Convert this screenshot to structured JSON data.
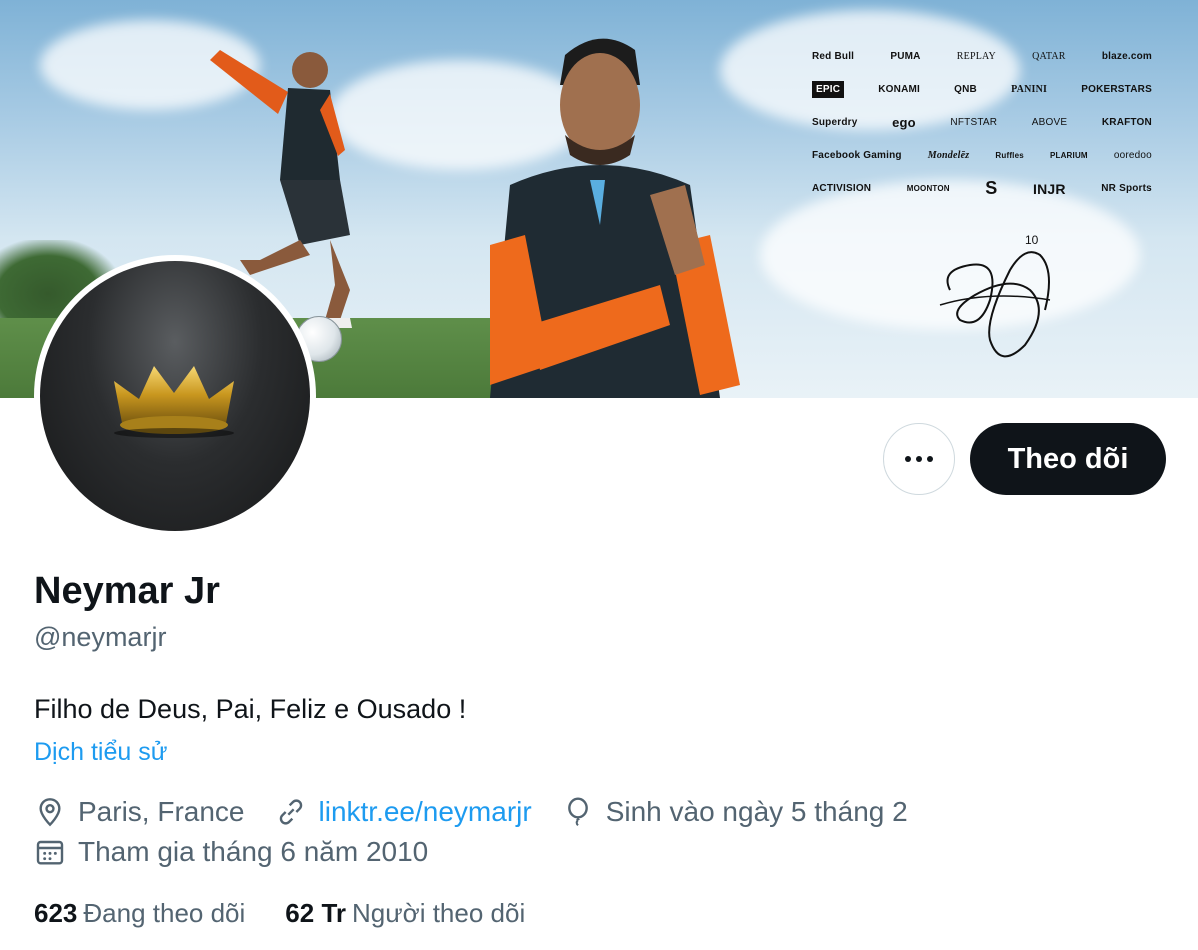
{
  "banner": {
    "sponsors": [
      [
        "Red Bull",
        "PUMA",
        "REPLAY",
        "QATAR",
        "blaze.com"
      ],
      [
        "EPIC",
        "KONAMI",
        "QNB",
        "PANINI",
        "POKERSTARS"
      ],
      [
        "Superdry",
        "ego",
        "NFTSTAR",
        "ABOVE",
        "KRAFTON"
      ],
      [
        "Facebook Gaming",
        "Mondelēz",
        "Ruffles",
        "PLARIUM",
        "ooredoo"
      ],
      [
        "ACTIVISION",
        "MOONTON",
        "S",
        "INJR",
        "NR Sports"
      ]
    ],
    "signature_number": "10"
  },
  "profile": {
    "name": "Neymar Jr",
    "handle": "@neymarjr",
    "bio": "Filho de Deus, Pai, Feliz e Ousado !",
    "translate_label": "Dịch tiểu sử",
    "location": "Paris, France",
    "website": "linktr.ee/neymarjr",
    "birthday": "Sinh vào ngày 5 tháng 2",
    "joined": "Tham gia tháng 6 năm 2010"
  },
  "actions": {
    "follow_label": "Theo dõi",
    "more_label": "•••"
  },
  "stats": {
    "following_count": "623",
    "following_label": "Đang theo dõi",
    "followers_count": "62 Tr",
    "followers_label": "Người theo dõi"
  },
  "colors": {
    "primary_text": "#0f1419",
    "secondary_text": "#536471",
    "link": "#1d9bf0",
    "button_dark": "#0f1419",
    "border": "#cfd9de"
  },
  "icons": {
    "location": "location-pin-icon",
    "website": "link-icon",
    "birthday": "balloon-icon",
    "joined": "calendar-icon",
    "more": "more-dots-icon"
  }
}
